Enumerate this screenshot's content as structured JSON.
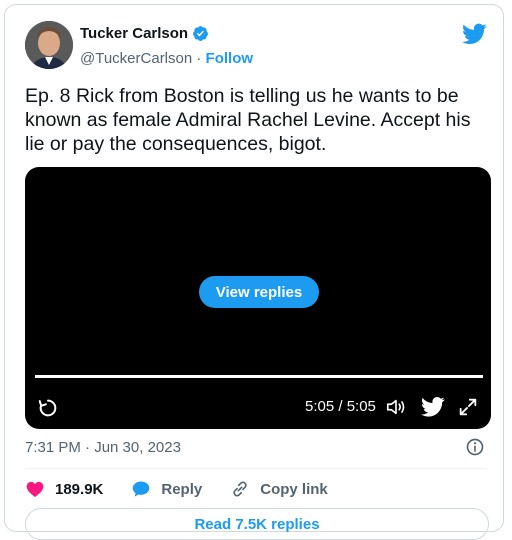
{
  "author": {
    "name": "Tucker Carlson",
    "handle": "@TuckerCarlson",
    "separator": " · ",
    "follow_label": "Follow",
    "verified": true
  },
  "tweet": {
    "text": "Ep. 8  Rick from Boston is telling us he wants to be known as female Admiral Rachel Levine. Accept his lie or pay the consequences, bigot.",
    "timestamp": "7:31 PM · Jun 30, 2023"
  },
  "video": {
    "overlay_button": "View replies",
    "time_readout": "5:05 / 5:05",
    "progress_fraction": 1.0,
    "controls": [
      "replay-icon",
      "volume-icon",
      "twitter-bird-icon",
      "fullscreen-icon"
    ]
  },
  "actions": {
    "likes_count": "189.9K",
    "reply_label": "Reply",
    "copy_link_label": "Copy link"
  },
  "read_replies_label": "Read 7.5K replies",
  "colors": {
    "accent": "#1d9bf0",
    "like": "#f91880",
    "text": "#0f1419",
    "muted": "#536471",
    "border": "#cfd9de"
  }
}
